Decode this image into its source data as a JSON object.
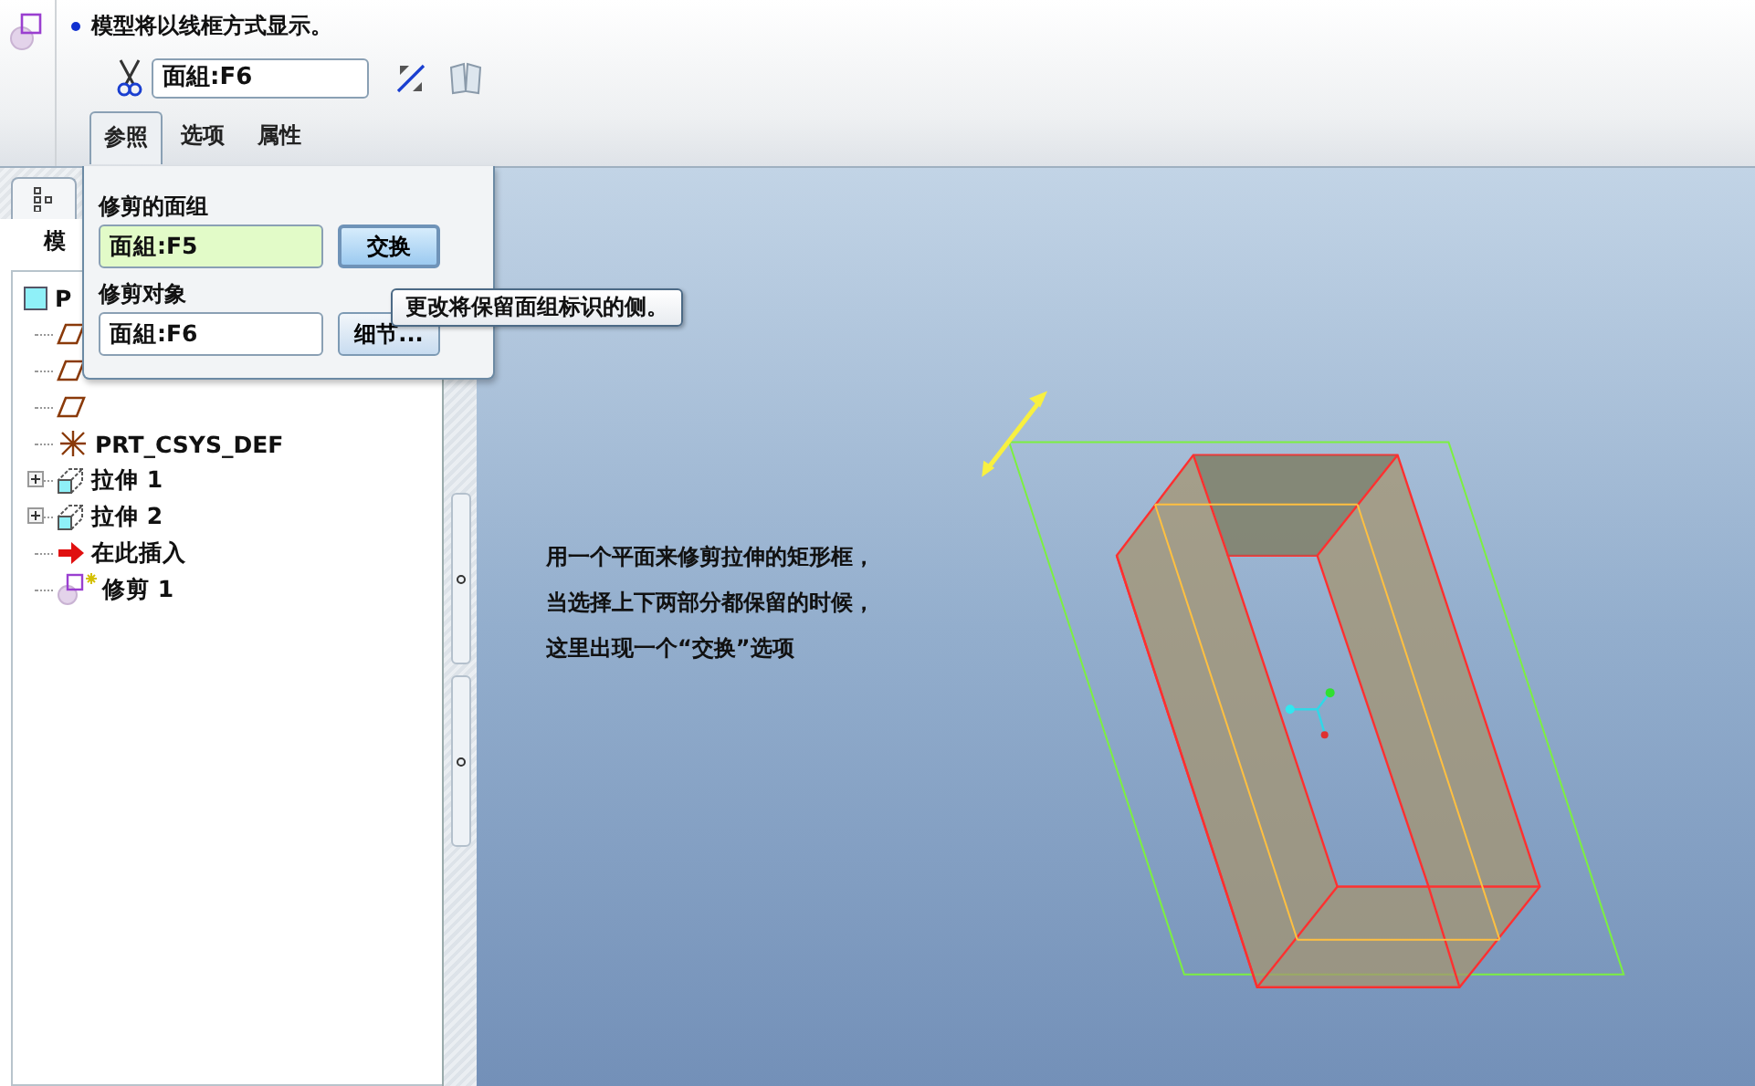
{
  "dashboard": {
    "message": "模型将以线框方式显示。",
    "collector": {
      "value": "面組:F6"
    },
    "tabs": [
      {
        "label": "参照",
        "selected": true
      },
      {
        "label": "选项",
        "selected": false
      },
      {
        "label": "属性",
        "selected": false
      }
    ]
  },
  "references_panel": {
    "sections": [
      {
        "label": "修剪的面组",
        "value": "面組:F5",
        "active": true,
        "button": "交换"
      },
      {
        "label": "修剪对象",
        "value": "面組:F6",
        "active": false,
        "button": "细节..."
      }
    ]
  },
  "tooltip": "更改将保留面组标识的侧。",
  "model_tree": {
    "title": "模",
    "root": {
      "label": "P",
      "children": [
        {
          "kind": "plane"
        },
        {
          "kind": "plane"
        },
        {
          "kind": "plane"
        },
        {
          "kind": "csys",
          "label": "PRT_CSYS_DEF"
        },
        {
          "kind": "extrude",
          "label": "拉伸 1",
          "expanded": false
        },
        {
          "kind": "extrude",
          "label": "拉伸 2",
          "expanded": false
        },
        {
          "kind": "insert",
          "label": "在此插入"
        },
        {
          "kind": "trim",
          "label": "修剪 1"
        }
      ]
    }
  },
  "viewport": {
    "annotation": [
      "用一个平面来修剪拉伸的矩形框，",
      "当选择上下两部分都保留的时候，",
      "这里出现一个“交换”选项"
    ]
  }
}
